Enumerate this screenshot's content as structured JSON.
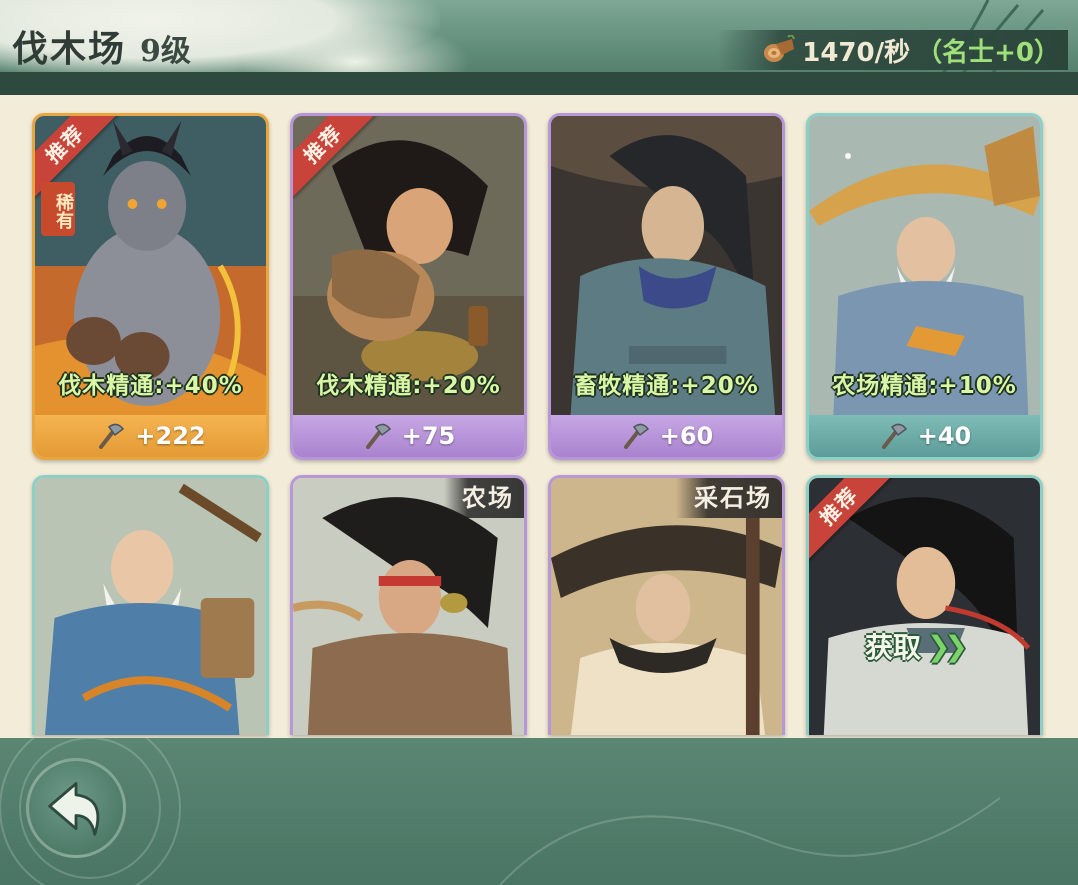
{
  "header": {
    "title": "伐木场",
    "level": "9级",
    "rate": "1470/秒",
    "bonus": "（名士+0）"
  },
  "icons": {
    "resource": "wood-log-icon",
    "power": "axe-icon",
    "back": "back-arrow-icon"
  },
  "cards": [
    {
      "frame": "orange",
      "ribbon": "推荐",
      "badge": "稀有",
      "bonus": "伐木精通:+40%",
      "power": "+222"
    },
    {
      "frame": "purple",
      "ribbon": "推荐",
      "bonus": "伐木精通:+20%",
      "power": "+75"
    },
    {
      "frame": "purple",
      "bonus": "畜牧精通:+20%",
      "power": "+60"
    },
    {
      "frame": "teal",
      "bonus": "农场精通:+10%",
      "power": "+40"
    },
    {
      "frame": "teal"
    },
    {
      "frame": "purple",
      "building": "农场"
    },
    {
      "frame": "purple",
      "building": "采石场"
    },
    {
      "frame": "teal",
      "ribbon": "推荐",
      "action": "获取"
    }
  ],
  "colors": {
    "header_green": "#5e8b78",
    "bar_dark": "#2e4a3f",
    "orange_frame": "#e8a640",
    "purple_frame": "#b797d8",
    "teal_frame": "#8ccfc7",
    "bonus_text": "#d9f7a6",
    "ribbon_red": "#c8433a"
  }
}
